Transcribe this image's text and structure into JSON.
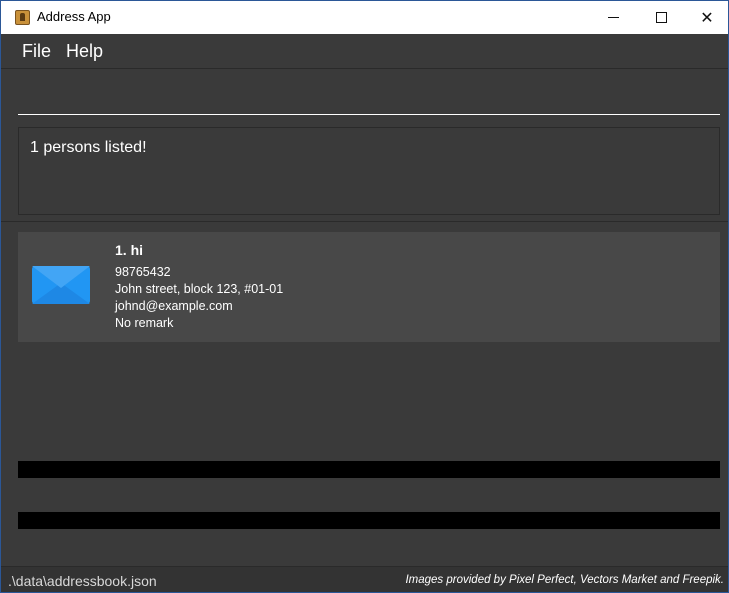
{
  "window": {
    "title": "Address App",
    "icon": "address-book-icon"
  },
  "menu": {
    "file": "File",
    "help": "Help"
  },
  "command": {
    "value": "",
    "placeholder": ""
  },
  "result": {
    "text": "1 persons listed!"
  },
  "persons": [
    {
      "index_name": "1.  hi",
      "phone": "98765432",
      "address": "John street, block 123, #01-01",
      "email": "johnd@example.com",
      "remark": "No remark",
      "icon": "envelope-icon"
    }
  ],
  "status": {
    "path": ".\\data\\addressbook.json",
    "credit": "Images provided by Pixel Perfect, Vectors Market and Freepik."
  },
  "colors": {
    "background": "#3a3a3a",
    "card": "#484848",
    "envelope": "#2196f3"
  }
}
